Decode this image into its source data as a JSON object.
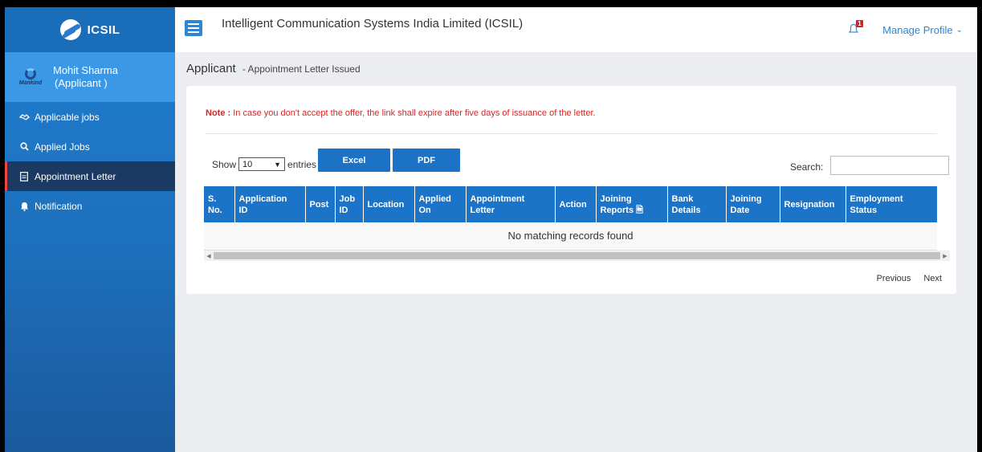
{
  "brand": {
    "name": "ICSIL"
  },
  "user": {
    "name": "Mohit Sharma",
    "role": "(Applicant )",
    "logo_text": "Mankind"
  },
  "sidebar": {
    "items": [
      {
        "label": "Applicable jobs",
        "icon": "handshake-icon"
      },
      {
        "label": "Applied Jobs",
        "icon": "search-icon"
      },
      {
        "label": "Appointment Letter",
        "icon": "document-icon",
        "active": true
      },
      {
        "label": "Notification",
        "icon": "bell-icon"
      }
    ]
  },
  "header": {
    "org_title": "Intelligent Communication Systems India Limited (ICSIL)",
    "notification_count": "1",
    "manage_profile": "Manage Profile"
  },
  "page": {
    "title": "Applicant",
    "subtitle": "- Appointment Letter Issued",
    "note_label": "Note :",
    "note_text": "In case you don't accept the offer, the link shall expire after five days of issuance of the letter."
  },
  "table_controls": {
    "show_label": "Show",
    "entries_value": "10",
    "entries_label": "entries",
    "excel_label": "Excel",
    "pdf_label": "PDF",
    "search_label": "Search:",
    "search_value": ""
  },
  "table": {
    "headers": [
      {
        "line1": "S.",
        "line2": "No."
      },
      {
        "line1": "Application",
        "line2": "ID"
      },
      {
        "line1": "Post",
        "line2": ""
      },
      {
        "line1": "Job",
        "line2": "ID"
      },
      {
        "line1": "Location",
        "line2": ""
      },
      {
        "line1": "Applied",
        "line2": "On"
      },
      {
        "line1": "Appointment",
        "line2": "Letter"
      },
      {
        "line1": "Action",
        "line2": ""
      },
      {
        "line1": "Joining",
        "line2": "Reports"
      },
      {
        "line1": "Bank",
        "line2": "Details"
      },
      {
        "line1": "Joining",
        "line2": "Date"
      },
      {
        "line1": "Resignation",
        "line2": ""
      },
      {
        "line1": "Employment",
        "line2": "Status"
      }
    ],
    "empty_message": "No matching records found"
  },
  "pagination": {
    "previous": "Previous",
    "next": "Next"
  },
  "colors": {
    "primary": "#1c74c8",
    "note_red": "#d72626",
    "sidebar_active": "#1a3a63"
  }
}
